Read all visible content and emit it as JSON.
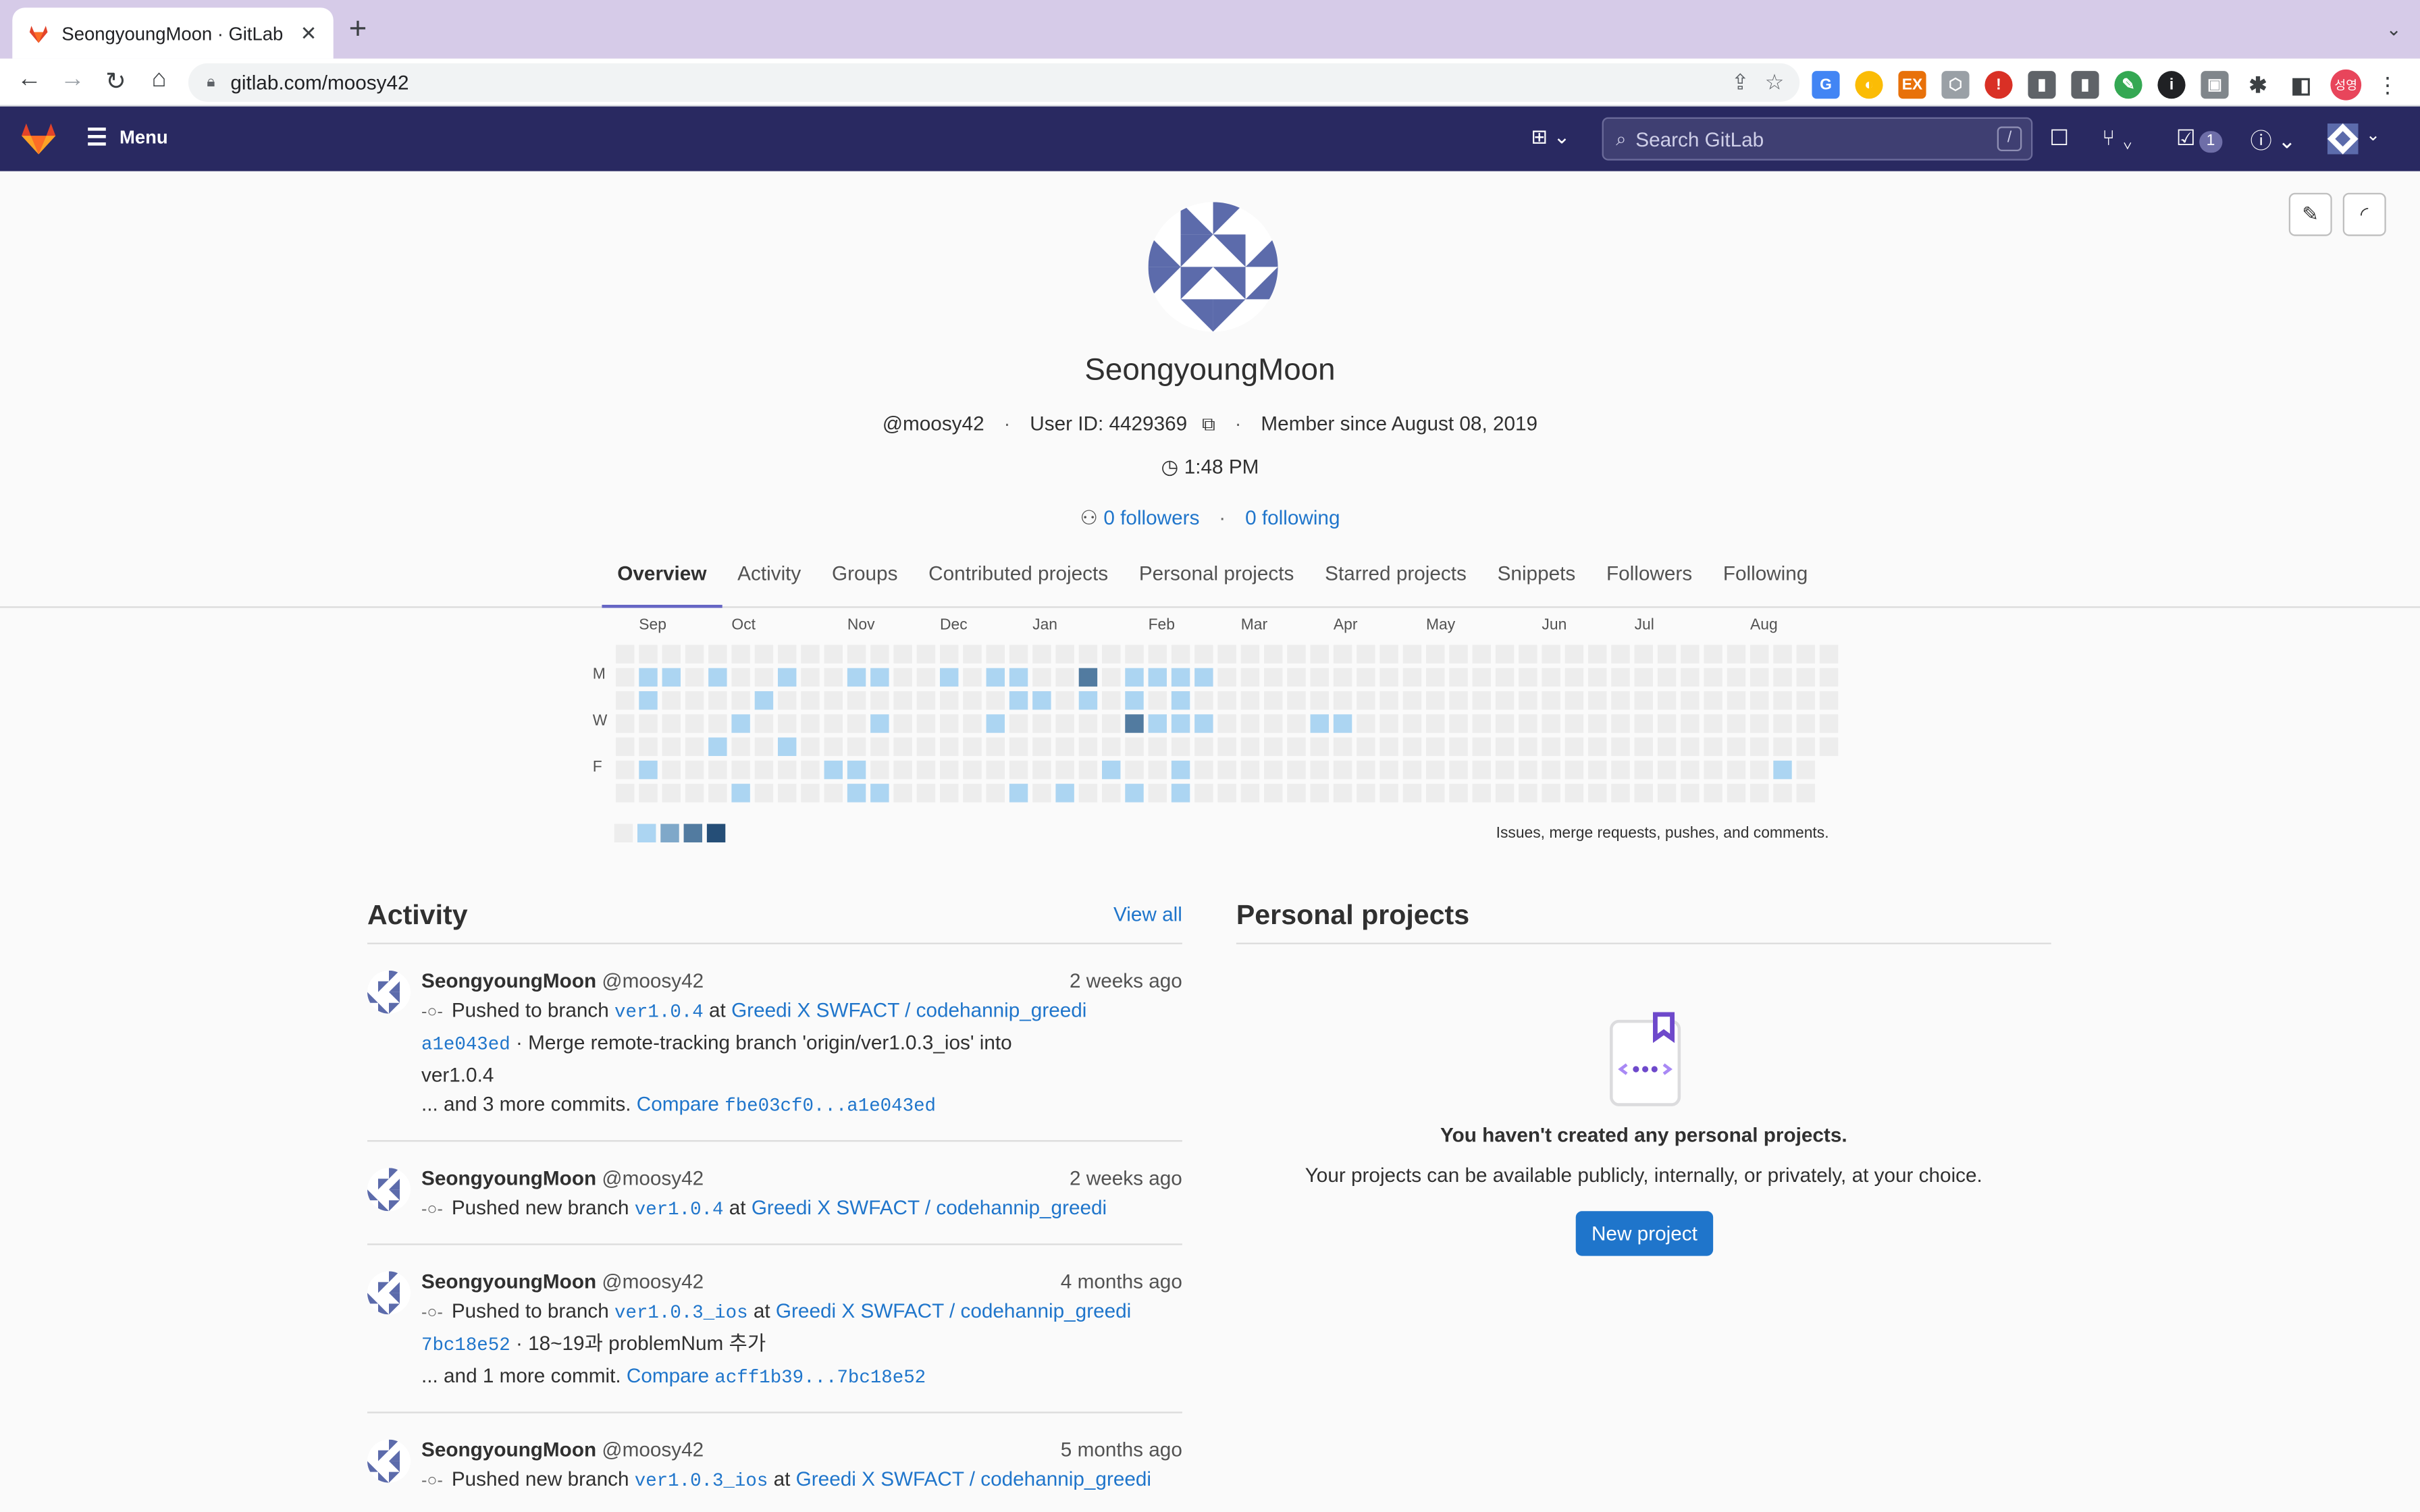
{
  "browser": {
    "tab_title": "SeongyoungMoon · GitLab",
    "url": "gitlab.com/moosy42",
    "profile_initials": "성영"
  },
  "header": {
    "menu_label": "Menu",
    "search_placeholder": "Search GitLab",
    "search_shortcut": "/",
    "todo_count": "1"
  },
  "profile": {
    "name": "SeongyoungMoon",
    "handle": "@moosy42",
    "user_id": "User ID: 4429369",
    "member_since": "Member since August 08, 2019",
    "local_time": "1:48 PM",
    "followers": "0 followers",
    "following": "0 following"
  },
  "tabs": [
    "Overview",
    "Activity",
    "Groups",
    "Contributed projects",
    "Personal projects",
    "Starred projects",
    "Snippets",
    "Followers",
    "Following"
  ],
  "calendar": {
    "months": [
      "Sep",
      "Oct",
      "Nov",
      "Dec",
      "Jan",
      "Feb",
      "Mar",
      "Apr",
      "May",
      "Jun",
      "Jul",
      "Aug"
    ],
    "day_labels": [
      "M",
      "W",
      "F"
    ],
    "note": "Issues, merge requests, pushes, and comments.",
    "level_colors": [
      "#ededed",
      "#acd5f2",
      "#7fa8c9",
      "#527ba0",
      "#254e77"
    ],
    "contributions": [
      [
        1,
        1,
        1
      ],
      [
        1,
        2,
        1
      ],
      [
        1,
        5,
        1
      ],
      [
        2,
        1,
        1
      ],
      [
        4,
        1,
        1
      ],
      [
        4,
        4,
        1
      ],
      [
        5,
        6,
        1
      ],
      [
        5,
        3,
        1
      ],
      [
        6,
        2,
        1
      ],
      [
        7,
        1,
        1
      ],
      [
        7,
        4,
        1
      ],
      [
        9,
        5,
        1
      ],
      [
        10,
        1,
        1
      ],
      [
        10,
        5,
        1
      ],
      [
        10,
        6,
        1
      ],
      [
        11,
        1,
        1
      ],
      [
        11,
        3,
        1
      ],
      [
        11,
        6,
        1
      ],
      [
        14,
        1,
        1
      ],
      [
        16,
        1,
        1
      ],
      [
        16,
        3,
        1
      ],
      [
        17,
        1,
        1
      ],
      [
        17,
        2,
        1
      ],
      [
        17,
        6,
        1
      ],
      [
        18,
        2,
        1
      ],
      [
        19,
        6,
        1
      ],
      [
        19,
        7,
        1
      ],
      [
        20,
        1,
        3
      ],
      [
        20,
        2,
        1
      ],
      [
        21,
        5,
        1
      ],
      [
        21,
        7,
        1
      ],
      [
        22,
        1,
        1
      ],
      [
        22,
        2,
        1
      ],
      [
        22,
        3,
        3
      ],
      [
        22,
        6,
        1
      ],
      [
        23,
        1,
        1
      ],
      [
        23,
        3,
        1
      ],
      [
        24,
        1,
        1
      ],
      [
        24,
        2,
        1
      ],
      [
        24,
        3,
        1
      ],
      [
        24,
        5,
        1
      ],
      [
        24,
        6,
        1
      ],
      [
        25,
        1,
        1
      ],
      [
        25,
        3,
        1
      ],
      [
        30,
        3,
        1
      ],
      [
        31,
        3,
        1
      ],
      [
        50,
        5,
        1
      ]
    ]
  },
  "activity": {
    "title": "Activity",
    "view_all": "View all",
    "events": [
      {
        "name": "SeongyoungMoon",
        "handle": "@moosy42",
        "time": "2 weeks ago",
        "action": "Pushed to branch",
        "branch": "ver1.0.4",
        "at": "at",
        "project": "Greedi X SWFACT / codehannip_greedi",
        "commit_sha": "a1e043ed",
        "commit_msg": "· Merge remote-tracking branch 'origin/ver1.0.3_ios' into ver1.0.4",
        "more": "... and 3 more commits.",
        "compare_label": "Compare",
        "compare_range": "fbe03cf0...a1e043ed"
      },
      {
        "name": "SeongyoungMoon",
        "handle": "@moosy42",
        "time": "2 weeks ago",
        "action": "Pushed new branch",
        "branch": "ver1.0.4",
        "at": "at",
        "project": "Greedi X SWFACT / codehannip_greedi"
      },
      {
        "name": "SeongyoungMoon",
        "handle": "@moosy42",
        "time": "4 months ago",
        "action": "Pushed to branch",
        "branch": "ver1.0.3_ios",
        "at": "at",
        "project": "Greedi X SWFACT / codehannip_greedi",
        "commit_sha": "7bc18e52",
        "commit_msg": "· 18~19과 problemNum 추가",
        "more": "... and 1 more commit.",
        "compare_label": "Compare",
        "compare_range": "acff1b39...7bc18e52"
      },
      {
        "name": "SeongyoungMoon",
        "handle": "@moosy42",
        "time": "5 months ago",
        "action": "Pushed new branch",
        "branch": "ver1.0.3_ios",
        "at": "at",
        "project": "Greedi X SWFACT / codehannip_greedi"
      }
    ]
  },
  "projects": {
    "title": "Personal projects",
    "empty_title": "You haven't created any personal projects.",
    "empty_desc": "Your projects can be available publicly, internally, or privately, at your choice.",
    "new_project": "New project"
  },
  "colors": {
    "header_bg": "#292961",
    "link": "#1f75cb",
    "primary_button": "#1f75cb",
    "active_tab_border": "#6666c4"
  }
}
